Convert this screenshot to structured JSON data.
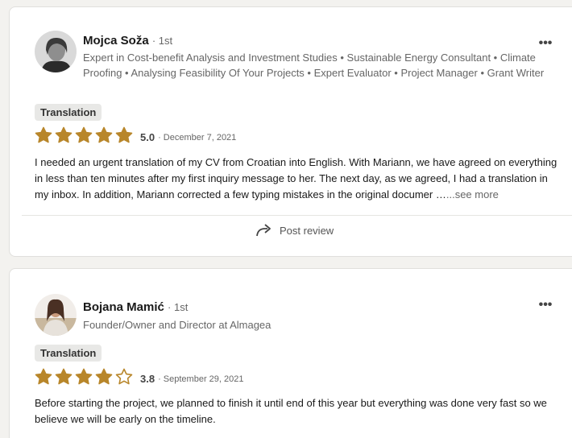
{
  "reviews": [
    {
      "name": "Mojca Soža",
      "degree": "· 1st",
      "headline": "Expert in Cost-benefit Analysis and Investment Studies • Sustainable Energy Consultant • Climate Proofing • Analysing Feasibility Of Your Projects • Expert Evaluator • Project Manager • Grant Writer",
      "tag": "Translation",
      "rating": 5.0,
      "score": "5.0",
      "date": "· December 7, 2021",
      "text": "I needed an urgent translation of my CV from Croatian into English. With Mariann, we have agreed on everything in less than ten minutes after my first inquiry message to her. The next day, as we agreed, I had a translation in my inbox. In addition, Mariann corrected a few typing mistakes in the original documer …",
      "see_more": "...see more",
      "post_review": "Post review"
    },
    {
      "name": "Bojana Mamić",
      "degree": "· 1st",
      "headline": "Founder/Owner and Director at Almagea",
      "tag": "Translation",
      "rating": 3.8,
      "score": "3.8",
      "date": "· September 29, 2021",
      "text": "Before starting the project, we planned to finish it until end of this year but everything was done very fast so we believe we will be early on the timeline."
    }
  ],
  "colors": {
    "star": "#b8862a",
    "star_empty": "#ffffff"
  },
  "icons": {
    "more": "more-horizontal-icon",
    "post": "share-arrow-icon"
  }
}
